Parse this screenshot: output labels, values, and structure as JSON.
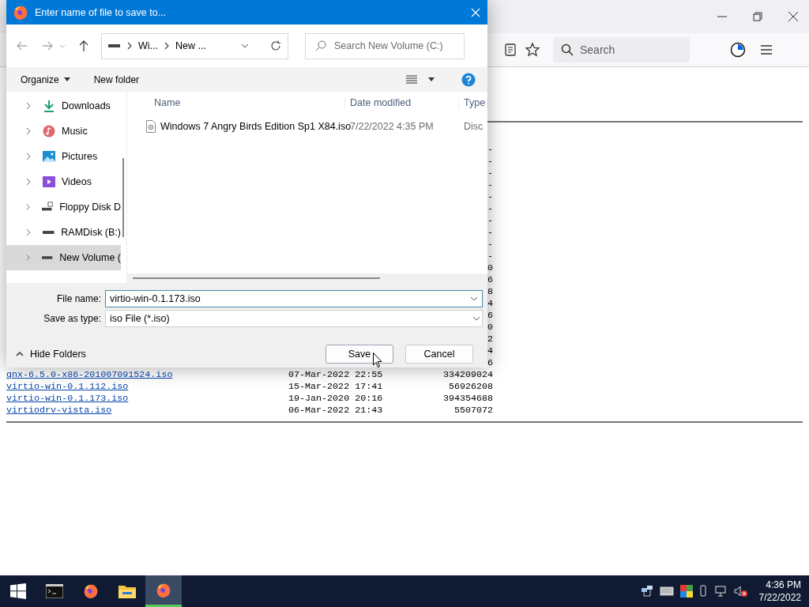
{
  "browser": {
    "search_placeholder": "Search"
  },
  "listing": {
    "rows": [
      {
        "size": "-"
      },
      {
        "size": "-"
      },
      {
        "size": "-"
      },
      {
        "size": "-"
      },
      {
        "size": "-"
      },
      {
        "size": "-"
      },
      {
        "size": "-"
      },
      {
        "size": "-"
      },
      {
        "size": "-"
      },
      {
        "size": "-"
      },
      {
        "size": "0"
      },
      {
        "size": "6"
      },
      {
        "size": "8"
      },
      {
        "size": "4"
      },
      {
        "size": "6"
      },
      {
        "size": "0"
      },
      {
        "size": "2"
      },
      {
        "size": "4"
      },
      {
        "size": "6"
      },
      {
        "name": "qnx-6.5.0-x86-201007091524.iso",
        "date": "07-Mar-2022 22:55",
        "size": "334209024"
      },
      {
        "name": "virtio-win-0.1.112.iso",
        "date": "15-Mar-2022 17:41",
        "size": "56926208"
      },
      {
        "name": "virtio-win-0.1.173.iso",
        "date": "19-Jan-2020 20:16",
        "size": "394354688"
      },
      {
        "name": "virtiodrv-vista.iso",
        "date": "06-Mar-2022 21:43",
        "size": "5507072"
      }
    ]
  },
  "dialog": {
    "title": "Enter name of file to save to...",
    "breadcrumb": [
      "Wi...",
      "New ..."
    ],
    "search_placeholder": "Search New Volume (C:)",
    "organize": "Organize",
    "new_folder": "New folder",
    "nav_items": [
      {
        "label": "Downloads",
        "kind": "downloads",
        "selected": false
      },
      {
        "label": "Music",
        "kind": "music",
        "selected": false
      },
      {
        "label": "Pictures",
        "kind": "pictures",
        "selected": false
      },
      {
        "label": "Videos",
        "kind": "videos",
        "selected": false
      },
      {
        "label": "Floppy Disk D",
        "kind": "floppy",
        "selected": false
      },
      {
        "label": "RAMDisk (B:)",
        "kind": "drive",
        "selected": false
      },
      {
        "label": "New Volume (",
        "kind": "drive",
        "selected": true
      }
    ],
    "columns": [
      "Name",
      "Date modified",
      "Type"
    ],
    "files": [
      {
        "name": "Windows 7 Angry Birds Edition Sp1 X84.iso",
        "date": "7/22/2022 4:35 PM",
        "type": "Disc"
      }
    ],
    "file_name": {
      "label": "File name:",
      "value": "virtio-win-0.1.173.iso"
    },
    "save_as_type": {
      "label": "Save as type:",
      "value": "iso File (*.iso)"
    },
    "hide_folders": "Hide Folders",
    "buttons": [
      {
        "label": "Save",
        "kind": "primary"
      },
      {
        "label": "Cancel",
        "kind": "secondary"
      }
    ]
  },
  "taskbar": {
    "apps": [
      {
        "kind": "terminal",
        "active": false
      },
      {
        "kind": "firefox",
        "active": false
      },
      {
        "kind": "folder",
        "active": false
      },
      {
        "kind": "firefox",
        "active": true
      }
    ],
    "time": "4:36 PM",
    "date": "7/22/2022"
  }
}
